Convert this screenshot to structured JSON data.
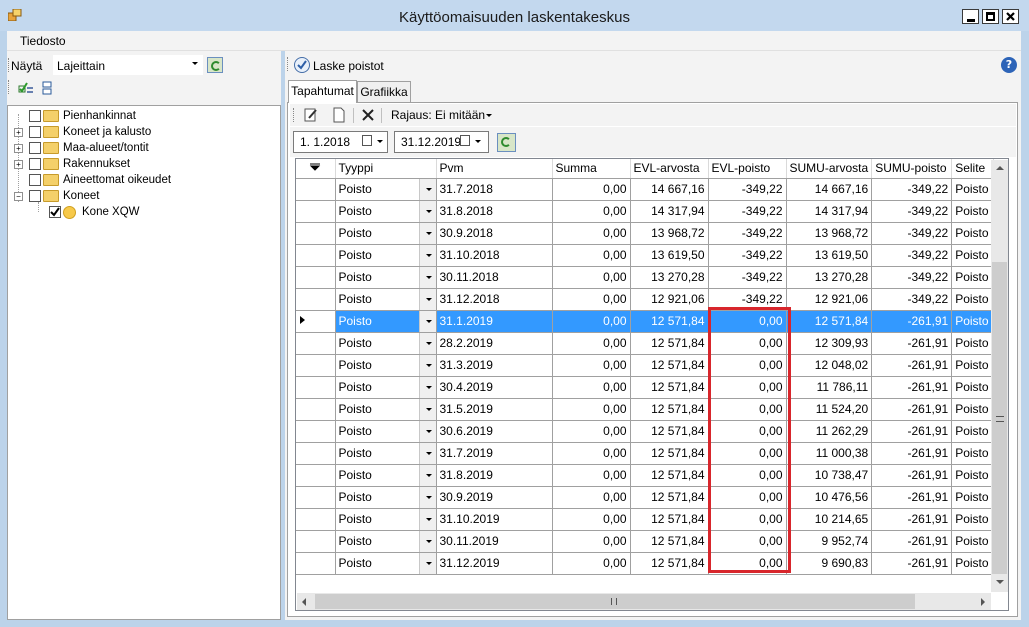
{
  "window": {
    "title": "Käyttöomaisuuden laskentakeskus"
  },
  "menu": {
    "file": "Tiedosto"
  },
  "left": {
    "show_label": "Näytä",
    "show_value": "Lajeittain",
    "tree": [
      {
        "label": "Pienhankinnat",
        "expandable": false,
        "checked": false
      },
      {
        "label": "Koneet ja kalusto",
        "expandable": true,
        "checked": false
      },
      {
        "label": "Maa-alueet/tontit",
        "expandable": true,
        "checked": false
      },
      {
        "label": "Rakennukset",
        "expandable": true,
        "checked": false
      },
      {
        "label": "Aineettomat oikeudet",
        "expandable": false,
        "checked": false
      },
      {
        "label": "Koneet",
        "expandable": true,
        "expanded": true,
        "checked": false
      },
      {
        "label": "Kone XQW",
        "child": true,
        "checked": true
      }
    ]
  },
  "right": {
    "calc_label": "Laske poistot",
    "tabs": [
      "Tapahtumat",
      "Grafiikka"
    ],
    "filter_label": "Rajaus: Ei mitään",
    "date_from": "1. 1.2018",
    "date_to": "31.12.2019"
  },
  "grid": {
    "headers": [
      "Tyyppi",
      "Pvm",
      "Summa",
      "EVL-arvosta",
      "EVL-poisto",
      "SUMU-arvosta",
      "SUMU-poisto",
      "Selite"
    ],
    "rows": [
      [
        "Poisto",
        "31.7.2018",
        "0,00",
        "14 667,16",
        "-349,22",
        "14 667,16",
        "-349,22",
        "Poisto"
      ],
      [
        "Poisto",
        "31.8.2018",
        "0,00",
        "14 317,94",
        "-349,22",
        "14 317,94",
        "-349,22",
        "Poisto"
      ],
      [
        "Poisto",
        "30.9.2018",
        "0,00",
        "13 968,72",
        "-349,22",
        "13 968,72",
        "-349,22",
        "Poisto"
      ],
      [
        "Poisto",
        "31.10.2018",
        "0,00",
        "13 619,50",
        "-349,22",
        "13 619,50",
        "-349,22",
        "Poisto"
      ],
      [
        "Poisto",
        "30.11.2018",
        "0,00",
        "13 270,28",
        "-349,22",
        "13 270,28",
        "-349,22",
        "Poisto"
      ],
      [
        "Poisto",
        "31.12.2018",
        "0,00",
        "12 921,06",
        "-349,22",
        "12 921,06",
        "-349,22",
        "Poisto"
      ],
      [
        "Poisto",
        "31.1.2019",
        "0,00",
        "12 571,84",
        "0,00",
        "12 571,84",
        "-261,91",
        "Poisto"
      ],
      [
        "Poisto",
        "28.2.2019",
        "0,00",
        "12 571,84",
        "0,00",
        "12 309,93",
        "-261,91",
        "Poisto"
      ],
      [
        "Poisto",
        "31.3.2019",
        "0,00",
        "12 571,84",
        "0,00",
        "12 048,02",
        "-261,91",
        "Poisto"
      ],
      [
        "Poisto",
        "30.4.2019",
        "0,00",
        "12 571,84",
        "0,00",
        "11 786,11",
        "-261,91",
        "Poisto"
      ],
      [
        "Poisto",
        "31.5.2019",
        "0,00",
        "12 571,84",
        "0,00",
        "11 524,20",
        "-261,91",
        "Poisto"
      ],
      [
        "Poisto",
        "30.6.2019",
        "0,00",
        "12 571,84",
        "0,00",
        "11 262,29",
        "-261,91",
        "Poisto"
      ],
      [
        "Poisto",
        "31.7.2019",
        "0,00",
        "12 571,84",
        "0,00",
        "11 000,38",
        "-261,91",
        "Poisto"
      ],
      [
        "Poisto",
        "31.8.2019",
        "0,00",
        "12 571,84",
        "0,00",
        "10 738,47",
        "-261,91",
        "Poisto"
      ],
      [
        "Poisto",
        "30.9.2019",
        "0,00",
        "12 571,84",
        "0,00",
        "10 476,56",
        "-261,91",
        "Poisto"
      ],
      [
        "Poisto",
        "31.10.2019",
        "0,00",
        "12 571,84",
        "0,00",
        "10 214,65",
        "-261,91",
        "Poisto"
      ],
      [
        "Poisto",
        "30.11.2019",
        "0,00",
        "12 571,84",
        "0,00",
        "9 952,74",
        "-261,91",
        "Poisto"
      ],
      [
        "Poisto",
        "31.12.2019",
        "0,00",
        "12 571,84",
        "0,00",
        "9 690,83",
        "-261,91",
        "Poisto"
      ]
    ],
    "selected_row": 6
  },
  "colors": {
    "selection": "#3399ff",
    "highlight_box": "#d8262c"
  },
  "icons": {
    "app": "app-icon",
    "calc": "check-circle-icon",
    "help": "help-icon",
    "refresh": "refresh-icon"
  }
}
